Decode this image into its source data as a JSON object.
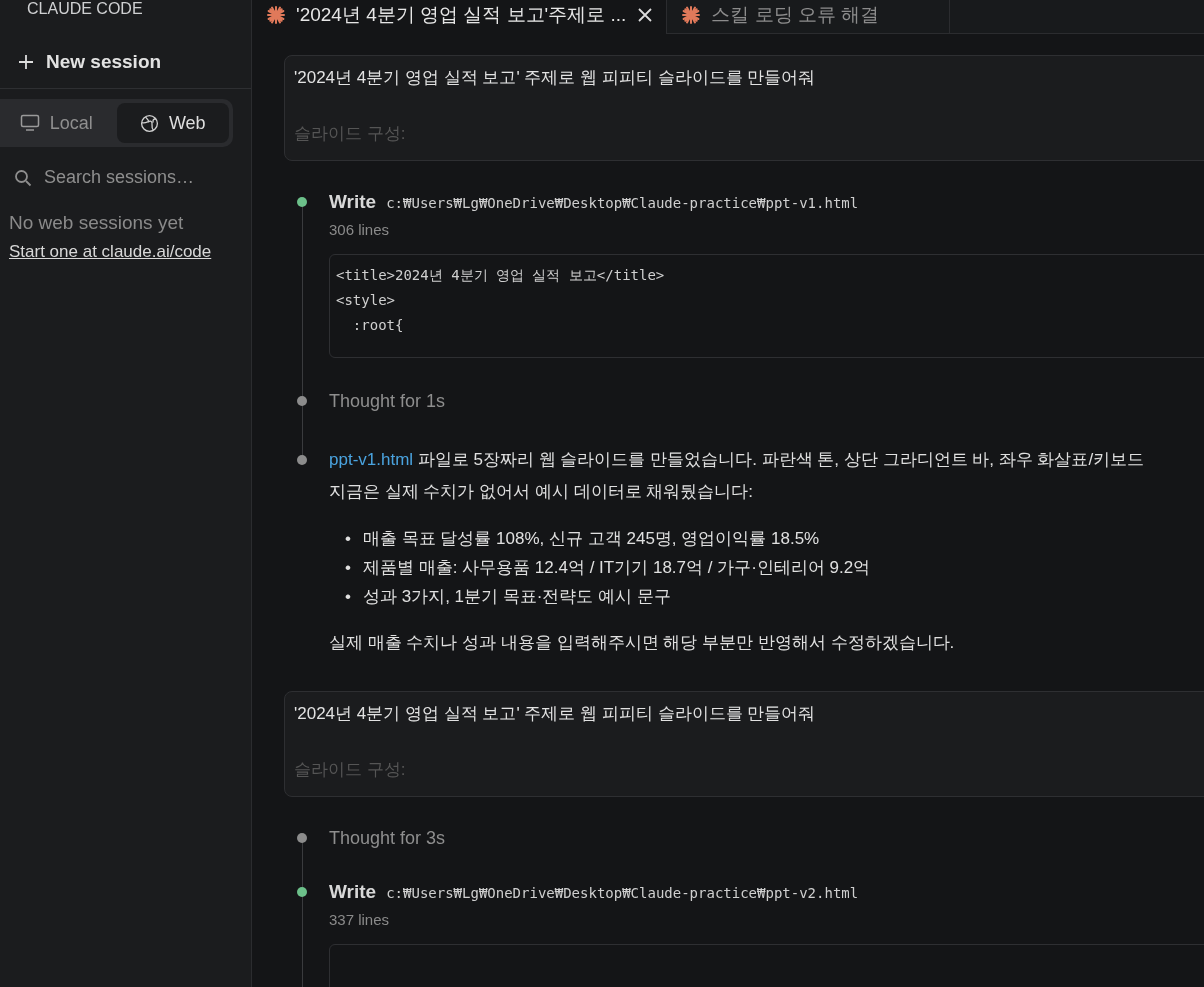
{
  "sidebar": {
    "brand": "CLAUDE CODE",
    "new_session": "New session",
    "modes": [
      {
        "label": "Local",
        "selected": false
      },
      {
        "label": "Web",
        "selected": true
      }
    ],
    "search": {
      "placeholder": "Search sessions…"
    },
    "empty_text": "No web sessions yet",
    "link": "Start one at claude.ai/code"
  },
  "tabs": [
    {
      "label": "'2024년 4분기 영업 실적 보고'주제로 ...",
      "selected": true,
      "closable": true
    },
    {
      "label": "스킬 로딩 오류 해결",
      "selected": false,
      "closable": false
    }
  ],
  "timeline": [
    {
      "kind": "prompt",
      "text": "'2024년 4분기 영업 실적 보고' 주제로 웹 피피티 슬라이드를 만들어줘",
      "subtext": "슬라이드 구성:"
    },
    {
      "kind": "write",
      "color": "#6cc08a",
      "tool": "Write",
      "path": "c:₩Users₩Lg₩OneDrive₩Desktop₩Claude-practice₩ppt-v1.html",
      "meta": "306 lines",
      "code": [
        "<title>2024년 4분기 영업 실적 보고</title>",
        "<style>",
        "  :root{"
      ]
    },
    {
      "kind": "thought",
      "color": "#8c8c8c",
      "text": "Thought for 1s"
    },
    {
      "kind": "message",
      "color": "#8c8c8c",
      "link": "ppt-v1.html",
      "lines": [
        "파일로 5장짜리 웹 슬라이드를 만들었습니다. 파란색 톤, 상단 그라디언트 바, 좌우 화살표/키보드",
        "지금은 실제 수치가 없어서 예시 데이터로 채워뒀습니다:"
      ],
      "bullets": [
        {
          "marker": "•",
          "text": "매출 목표 달성률 108%, 신규 고객 245명, 영업이익률 18.5%"
        },
        {
          "marker": "•",
          "text": "제품별 매출: 사무용품 12.4억 / IT기기 18.7억 / 가구·인테리어 9.2억"
        },
        {
          "marker": "•",
          "text": "성과 3가지, 1분기 목표·전략도 예시 문구"
        }
      ],
      "closing": "실제 매출 수치나 성과 내용을 입력해주시면 해당 부분만 반영해서 수정하겠습니다."
    },
    {
      "kind": "prompt",
      "text": "'2024년 4분기 영업 실적 보고' 주제로 웹 피피티 슬라이드를 만들어줘",
      "subtext": "슬라이드 구성:"
    },
    {
      "kind": "thought",
      "color": "#8c8c8c",
      "text": "Thought for 3s"
    },
    {
      "kind": "write",
      "color": "#6cc08a",
      "tool": "Write",
      "path": "c:₩Users₩Lg₩OneDrive₩Desktop₩Claude-practice₩ppt-v2.html",
      "meta": "337 lines"
    }
  ]
}
